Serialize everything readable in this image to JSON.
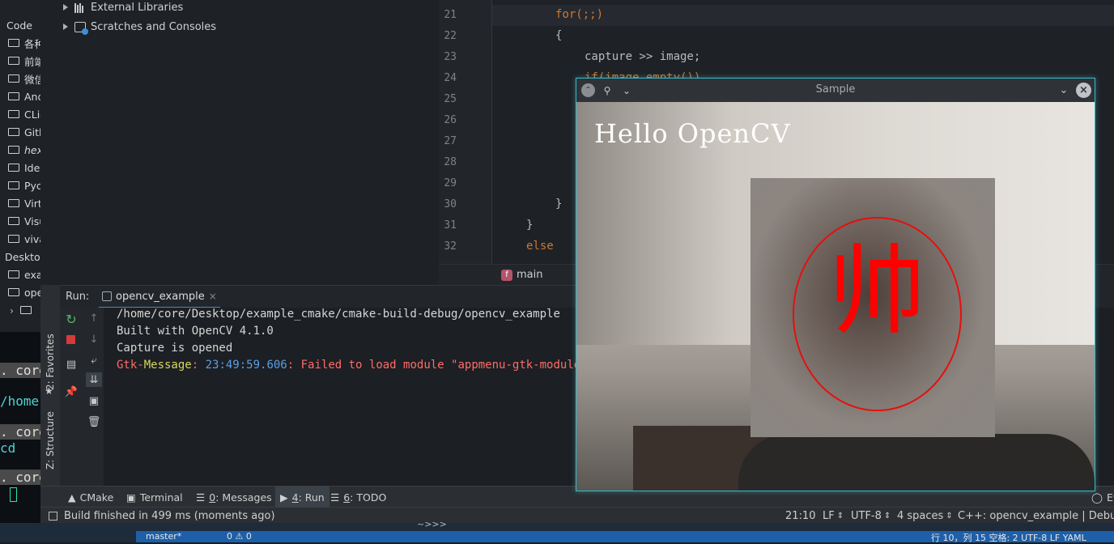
{
  "left_strip": {
    "section_code": "Code",
    "items": [
      "各种",
      "前端",
      "微信",
      "And",
      "CLio",
      "Gith",
      "hex",
      "Idea",
      "Pyc",
      "Virt",
      "Visu",
      "viva"
    ],
    "section_desktop": "Desktop",
    "desktop_items": [
      "exa",
      "ope"
    ]
  },
  "terminal": {
    "lines": [
      ". core",
      "/home",
      ". core",
      "  cd",
      ". core"
    ]
  },
  "project_tree": {
    "external_libraries": "External Libraries",
    "scratches": "Scratches and Consoles"
  },
  "editor": {
    "lines": [
      {
        "num": "21",
        "text": "for(;;)"
      },
      {
        "num": "22",
        "text": "{"
      },
      {
        "num": "23",
        "text": "capture >> image;"
      },
      {
        "num": "24",
        "text": "if(image.empty())"
      },
      {
        "num": "25",
        "text": ""
      },
      {
        "num": "26",
        "text": ""
      },
      {
        "num": "27",
        "text": ""
      },
      {
        "num": "28",
        "text": ""
      },
      {
        "num": "29",
        "text": ""
      },
      {
        "num": "30",
        "text": "}"
      },
      {
        "num": "31",
        "text": "}"
      },
      {
        "num": "32",
        "text": "else"
      }
    ],
    "breadcrumb": "main",
    "breadcrumb_badge": "f"
  },
  "run_panel": {
    "label": "Run:",
    "tab": "opencv_example",
    "vertical_tabs": [
      "2: Favorites",
      "Z: Structure"
    ],
    "console": {
      "line1": "/home/core/Desktop/example_cmake/cmake-build-debug/opencv_example",
      "line2": "Built with OpenCV 4.1.0",
      "line3": "Capture is opened",
      "gtk_prefix": "Gtk-",
      "gtk_message": "Message",
      "gtk_sep1": ": ",
      "gtk_time": "23:49:59.606",
      "gtk_rest": ": Failed to load module \"appmenu-gtk-module\""
    }
  },
  "bottom_tabs": {
    "cmake": "CMake",
    "terminal": "Terminal",
    "messages_num": "0",
    "messages": ": Messages",
    "run_num": "4",
    "run": ": Run",
    "todo_num": "6",
    "todo": ": TODO",
    "event_log": "Ev"
  },
  "status_bar": {
    "message": "Build finished in 499 ms (moments ago)",
    "position": "21:10",
    "line_sep": "LF",
    "encoding": "UTF-8",
    "indent": "4 spaces",
    "context": "C++: opencv_example | Debug"
  },
  "cv_window": {
    "title": "Sample",
    "overlay_text": "Hello OpenCV",
    "glyph": "帅"
  },
  "taskbar": {
    "branch": "master*",
    "prompt": "~>>>",
    "counts": "0 ⚠ 0",
    "right": "行 10，列 15   空格: 2   UTF-8   LF   YAML"
  },
  "colors": {
    "keyword": "#cc7832",
    "gtk_red": "#ff6b68",
    "gtk_yellow": "#d7d75f",
    "gtk_blue": "#5c9fe8",
    "cv_border": "#3ab7c8",
    "red_circle": "#e41010"
  }
}
